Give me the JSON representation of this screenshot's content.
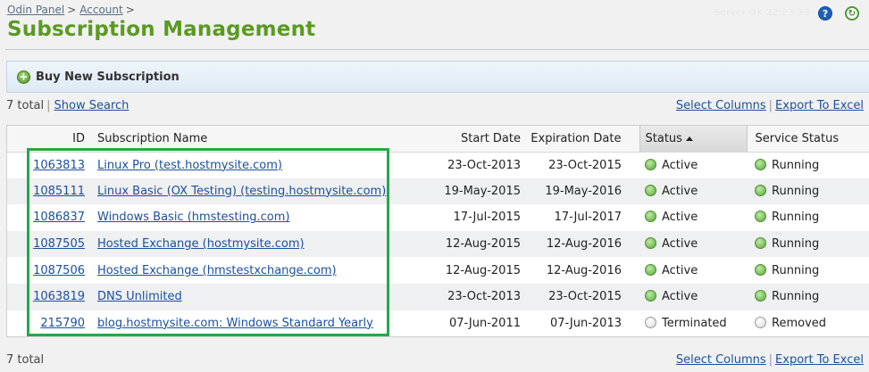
{
  "breadcrumb": [
    {
      "label": "Odin Panel",
      "sep": ">"
    },
    {
      "label": "Account",
      "sep": ">"
    }
  ],
  "user_info": "Server OK 22:23:33",
  "page_title": "Subscription Management",
  "action_bar": {
    "label": "Buy New Subscription",
    "icon": "plus-circle-icon"
  },
  "list_top": {
    "total": "7 total",
    "show_search": "Show Search",
    "select_columns": "Select Columns",
    "export": "Export To Excel"
  },
  "list_bottom": {
    "total": "7 total",
    "select_columns": "Select Columns",
    "export": "Export To Excel"
  },
  "table": {
    "headers": {
      "id": "ID",
      "name": "Subscription Name",
      "start": "Start Date",
      "exp": "Expiration Date",
      "status": "Status",
      "service": "Service Status"
    },
    "rows": [
      {
        "id": "1063813",
        "name": "Linux Pro (test.hostmysite.com)",
        "start": "23-Oct-2013",
        "exp": "23-Oct-2015",
        "status": "Active",
        "service": "Running"
      },
      {
        "id": "1085111",
        "name": "Linux Basic (OX Testing) (testing.hostmysite.com)",
        "start": "19-May-2015",
        "exp": "19-May-2016",
        "status": "Active",
        "service": "Running"
      },
      {
        "id": "1086837",
        "name": "Windows Basic (hmstesting.com)",
        "start": "17-Jul-2015",
        "exp": "17-Jul-2017",
        "status": "Active",
        "service": "Running"
      },
      {
        "id": "1087505",
        "name": "Hosted Exchange (hostmysite.com)",
        "start": "12-Aug-2015",
        "exp": "12-Aug-2016",
        "status": "Active",
        "service": "Running"
      },
      {
        "id": "1087506",
        "name": "Hosted Exchange (hmstestxchange.com)",
        "start": "12-Aug-2015",
        "exp": "12-Aug-2016",
        "status": "Active",
        "service": "Running"
      },
      {
        "id": "1063819",
        "name": "DNS Unlimited",
        "start": "23-Oct-2013",
        "exp": "23-Oct-2015",
        "status": "Active",
        "service": "Running"
      },
      {
        "id": "215790",
        "name": "blog.hostmysite.com: Windows Standard Yearly",
        "start": "07-Jun-2011",
        "exp": "07-Jun-2013",
        "status": "Terminated",
        "service": "Removed"
      }
    ]
  },
  "colors": {
    "title_green": "#5a9a21",
    "link_blue": "#1c4fa0",
    "highlight_green": "#23a94a",
    "active_dot": "#57a83a",
    "inactive_dot": "#d9d9d9"
  }
}
